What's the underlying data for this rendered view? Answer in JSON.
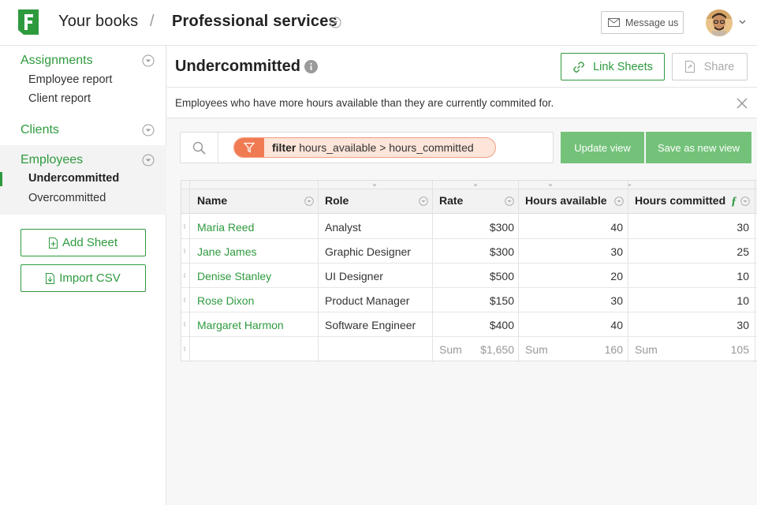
{
  "header": {
    "books_label": "Your books",
    "separator": "/",
    "workspace_title": "Professional services",
    "message_button": "Message us"
  },
  "sidebar": {
    "groups": [
      {
        "label": "Assignments",
        "items": [
          "Employee report",
          "Client report"
        ]
      },
      {
        "label": "Clients",
        "items": []
      },
      {
        "label": "Employees",
        "items": [
          "Undercommitted",
          "Overcommitted"
        ]
      }
    ],
    "add_sheet_label": "Add Sheet",
    "import_csv_label": "Import CSV"
  },
  "sheet": {
    "title": "Undercommitted",
    "link_sheets_label": "Link Sheets",
    "share_label": "Share",
    "description": "Employees who have more hours available than they are currently commited for."
  },
  "filter": {
    "keyword": "filter",
    "expression": "hours_available > hours_committed",
    "update_view_label": "Update view",
    "save_new_view_label": "Save as new view"
  },
  "table": {
    "columns": [
      "Name",
      "Role",
      "Rate",
      "Hours available",
      "Hours committed"
    ],
    "rows": [
      {
        "name": "Maria Reed",
        "role": "Analyst",
        "rate": "$300",
        "available": "40",
        "committed": "30"
      },
      {
        "name": "Jane James",
        "role": "Graphic Designer",
        "rate": "$300",
        "available": "30",
        "committed": "25"
      },
      {
        "name": "Denise Stanley",
        "role": "UI Designer",
        "rate": "$500",
        "available": "20",
        "committed": "10"
      },
      {
        "name": "Rose Dixon",
        "role": "Product Manager",
        "rate": "$150",
        "available": "30",
        "committed": "10"
      },
      {
        "name": "Margaret Harmon",
        "role": "Software Engineer",
        "rate": "$400",
        "available": "40",
        "committed": "30"
      }
    ],
    "sum_label": "Sum",
    "sums": {
      "rate": "$1,650",
      "available": "160",
      "committed": "105"
    },
    "formula_glyph": "ƒ"
  },
  "colors": {
    "accent": "#2e9a3e",
    "accent_light": "#74c27a",
    "filter_orange": "#f07a52",
    "filter_bg": "#fde5da"
  }
}
